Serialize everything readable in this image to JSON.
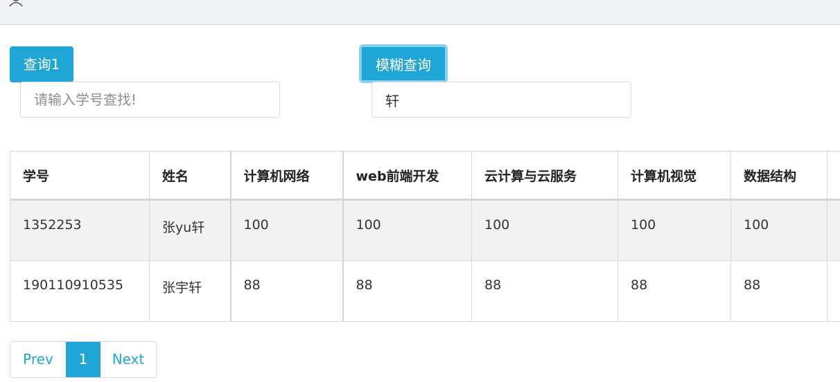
{
  "buttons": {
    "query1_label": "查询1",
    "fuzzy_label": "模糊查询"
  },
  "inputs": {
    "id_placeholder": "请输入学号查找!",
    "id_value": "",
    "fuzzy_value": "轩"
  },
  "table": {
    "headers": [
      "学号",
      "姓名",
      "计算机网络",
      "web前端开发",
      "云计算与云服务",
      "计算机视觉",
      "数据结构",
      ""
    ],
    "rows": [
      [
        "1352253",
        "张yu轩",
        "100",
        "100",
        "100",
        "100",
        "100",
        ""
      ],
      [
        "190110910535",
        "张宇轩",
        "88",
        "88",
        "88",
        "88",
        "88",
        ""
      ]
    ]
  },
  "pagination": {
    "prev_label": "Prev",
    "current_page": "1",
    "next_label": "Next"
  },
  "colors": {
    "accent": "#1fa6d7",
    "button_focus_ring": "#86d2ec",
    "striped_row": "#f2f2f2"
  }
}
